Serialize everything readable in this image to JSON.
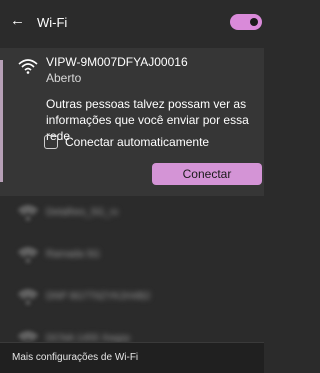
{
  "header": {
    "title": "Wi-Fi",
    "back_icon": "arrow-left-icon",
    "wifi_enabled": true
  },
  "selected_network": {
    "name": "VIPW-9M007DFYAJ00016",
    "status": "Aberto",
    "warning": "Outras pessoas talvez possam ver as informações que você enviar por essa rede",
    "auto_connect_label": "Conectar automaticamente",
    "auto_connect_checked": false,
    "connect_label": "Conectar"
  },
  "other_networks": [
    {
      "name": "Detalhes_5G_rx"
    },
    {
      "name": "Ramada 5G"
    },
    {
      "name": "DNP 8G7T6ZYK2H4B2"
    },
    {
      "name": "DCNA 1455 Xwgrp"
    }
  ],
  "footer": {
    "link": "Mais configurações de Wi-Fi"
  },
  "colors": {
    "background": "#2b2b2b",
    "selected_background": "#363636",
    "accent": "#d494d6",
    "footer_background": "#202020"
  }
}
